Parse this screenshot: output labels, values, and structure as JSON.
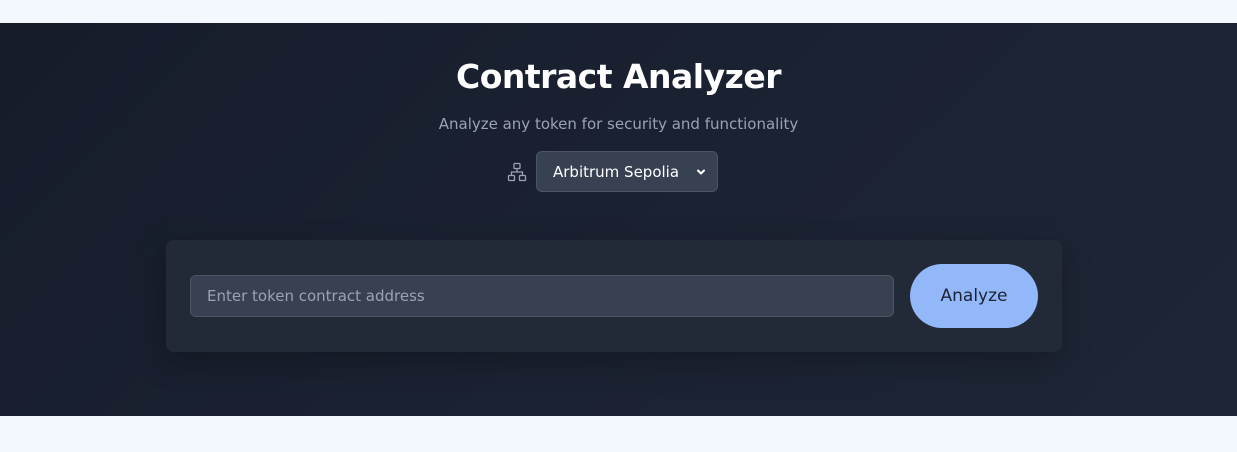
{
  "header": {
    "title": "Contract Analyzer",
    "subtitle": "Analyze any token for security and functionality"
  },
  "network": {
    "icon": "network-icon",
    "selected": "Arbitrum Sepolia"
  },
  "search": {
    "value": "",
    "placeholder": "Enter token contract address",
    "button_label": "Analyze"
  },
  "colors": {
    "hero_background": "#1b2232",
    "panel_background": "#222a38",
    "input_background": "#374151",
    "accent": "#93b8f9",
    "page_background": "#f3f7fe"
  }
}
